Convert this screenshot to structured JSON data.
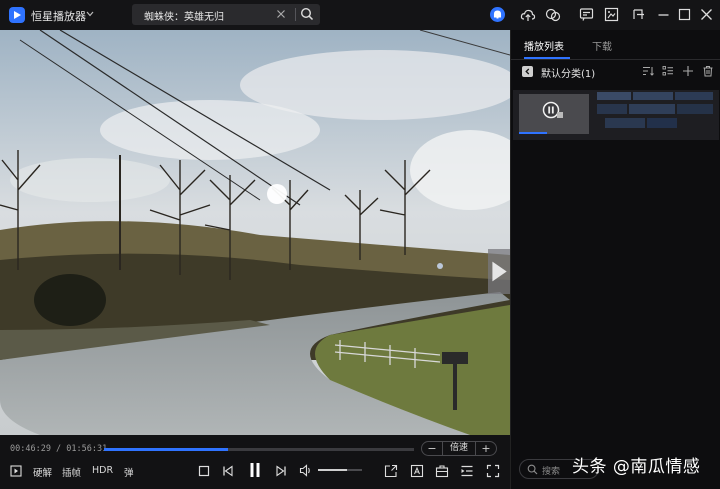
{
  "app": {
    "name": "恒星播放器"
  },
  "search": {
    "value": "蜘蛛侠：英雄无归"
  },
  "player": {
    "time": "00:46:29 / 01:56:31",
    "progress_fraction": 0.4,
    "volume_fraction": 0.65,
    "speed_label": "倍速",
    "speed_minus": "−",
    "speed_plus": "+",
    "hw_decode": "硬解",
    "frame_interp": "插帧",
    "hdr": "HDR",
    "danmaku": "弹"
  },
  "sidebar": {
    "tabs": [
      {
        "label": "播放列表",
        "active": true
      },
      {
        "label": "下载",
        "active": false
      }
    ],
    "category": "默认分类(1)",
    "search_placeholder": "搜索"
  },
  "watermark": "头条 @南瓜情感",
  "colors": {
    "accent": "#2f73ff",
    "background": "#0e0e10"
  },
  "icons": [
    "app-logo-icon",
    "chevron-down-icon",
    "close-icon",
    "search-icon",
    "notification-icon",
    "upload-icon",
    "share-icon",
    "subtitle-icon",
    "screenshot-icon",
    "pin-icon",
    "minimize-icon",
    "maximize-icon",
    "close-window-icon",
    "next-icon",
    "play-mode-icon",
    "stop-icon",
    "prev-icon",
    "pause-icon",
    "volume-icon",
    "pip-icon",
    "caption-icon",
    "toolbox-icon",
    "playlist-icon",
    "fullscreen-icon",
    "sort-icon",
    "list-icon",
    "add-icon",
    "delete-icon"
  ]
}
